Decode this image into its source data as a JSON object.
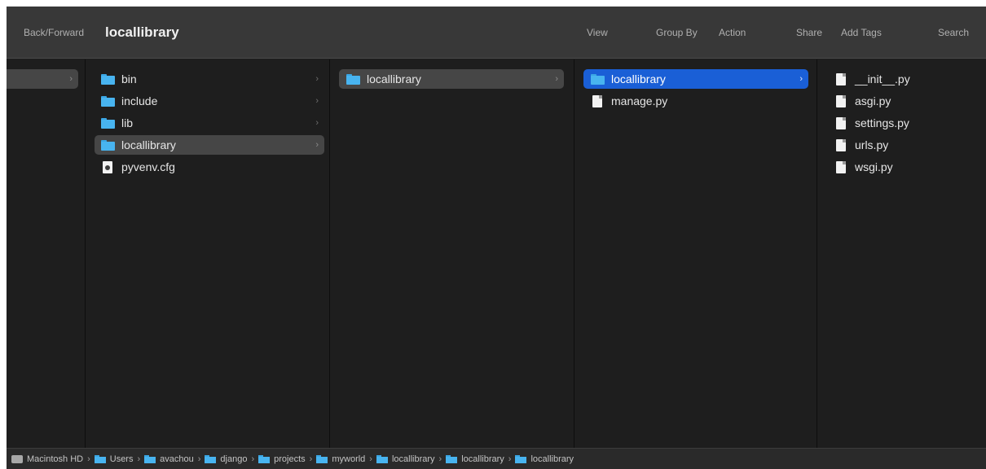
{
  "toolbar": {
    "back_forward": "Back/Forward",
    "title": "locallibrary",
    "view": "View",
    "group_by": "Group By",
    "action": "Action",
    "share": "Share",
    "add_tags": "Add Tags",
    "search": "Search"
  },
  "columns": {
    "col2": [
      {
        "label": "bin",
        "icon": "folder-icon"
      },
      {
        "label": "include",
        "icon": "folder-icon"
      },
      {
        "label": "lib",
        "icon": "folder-icon"
      },
      {
        "label": "locallibrary",
        "icon": "folder-icon",
        "selected": true
      },
      {
        "label": "pyvenv.cfg",
        "icon": "config-file-icon"
      }
    ],
    "col3": [
      {
        "label": "locallibrary",
        "icon": "folder-icon",
        "selected": true
      }
    ],
    "col4": [
      {
        "label": "locallibrary",
        "icon": "folder-icon",
        "selected": true,
        "active": true
      },
      {
        "label": "manage.py",
        "icon": "file-icon"
      }
    ],
    "col5": [
      {
        "label": "__init__.py",
        "icon": "file-icon"
      },
      {
        "label": "asgi.py",
        "icon": "file-icon"
      },
      {
        "label": "settings.py",
        "icon": "file-icon"
      },
      {
        "label": "urls.py",
        "icon": "file-icon"
      },
      {
        "label": "wsgi.py",
        "icon": "file-icon"
      }
    ]
  },
  "chevron": "›",
  "path_bar": [
    {
      "label": "Macintosh HD",
      "icon": "hard-drive-icon"
    },
    {
      "label": "Users",
      "icon": "folder-icon"
    },
    {
      "label": "avachou",
      "icon": "folder-icon"
    },
    {
      "label": "django",
      "icon": "folder-icon"
    },
    {
      "label": "projects",
      "icon": "folder-icon"
    },
    {
      "label": "myworld",
      "icon": "folder-icon"
    },
    {
      "label": "locallibrary",
      "icon": "folder-icon"
    },
    {
      "label": "locallibrary",
      "icon": "folder-icon"
    },
    {
      "label": "locallibrary",
      "icon": "folder-icon"
    }
  ],
  "colors": {
    "window_bg": "#1e1e1e",
    "toolbar_bg": "#383838",
    "selection_blue": "#1a5fd6",
    "selection_gray": "#464646",
    "folder_blue": "#48b4f0"
  }
}
